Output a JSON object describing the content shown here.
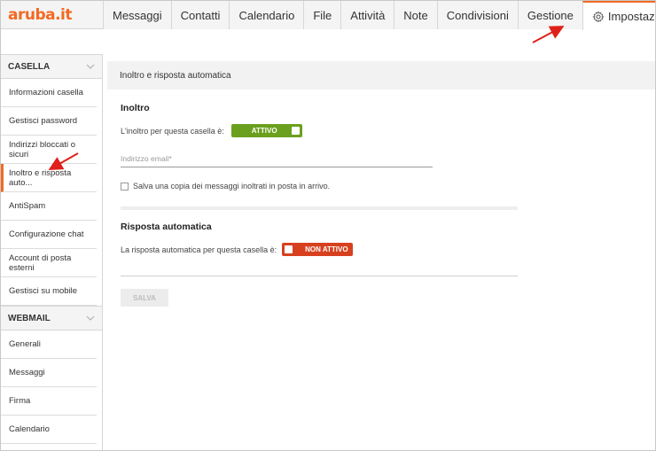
{
  "logo": "aruba.it",
  "tabs": [
    "Messaggi",
    "Contatti",
    "Calendario",
    "File",
    "Attività",
    "Note",
    "Condivisioni",
    "Gestione",
    "Impostazioni"
  ],
  "sidebar": {
    "casella_title": "CASELLA",
    "casella_items": [
      "Informazioni casella",
      "Gestisci password",
      "Indirizzi bloccati o sicuri",
      "Inoltro e risposta auto...",
      "AntiSpam",
      "Configurazione chat",
      "Account di posta esterni",
      "Gestisci su mobile"
    ],
    "webmail_title": "WEBMAIL",
    "webmail_items": [
      "Generali",
      "Messaggi",
      "Firma",
      "Calendario"
    ]
  },
  "main": {
    "panel_title": "Inoltro e risposta automatica",
    "inoltro_title": "Inoltro",
    "inoltro_label": "L'inoltro per questa casella è:",
    "inoltro_status": "ATTIVO",
    "email_placeholder": "Indirizzo email*",
    "copy_label": "Salva una copia dei messaggi inoltrati in posta in arrivo.",
    "risposta_title": "Risposta automatica",
    "risposta_label": "La risposta automatica per questa casella è:",
    "risposta_status": "NON ATTIVO",
    "save_label": "SALVA"
  },
  "colors": {
    "accent": "#f26922",
    "active": "#6ba01e",
    "inactive": "#d7401f",
    "annotation_arrow": "#e0201b"
  }
}
